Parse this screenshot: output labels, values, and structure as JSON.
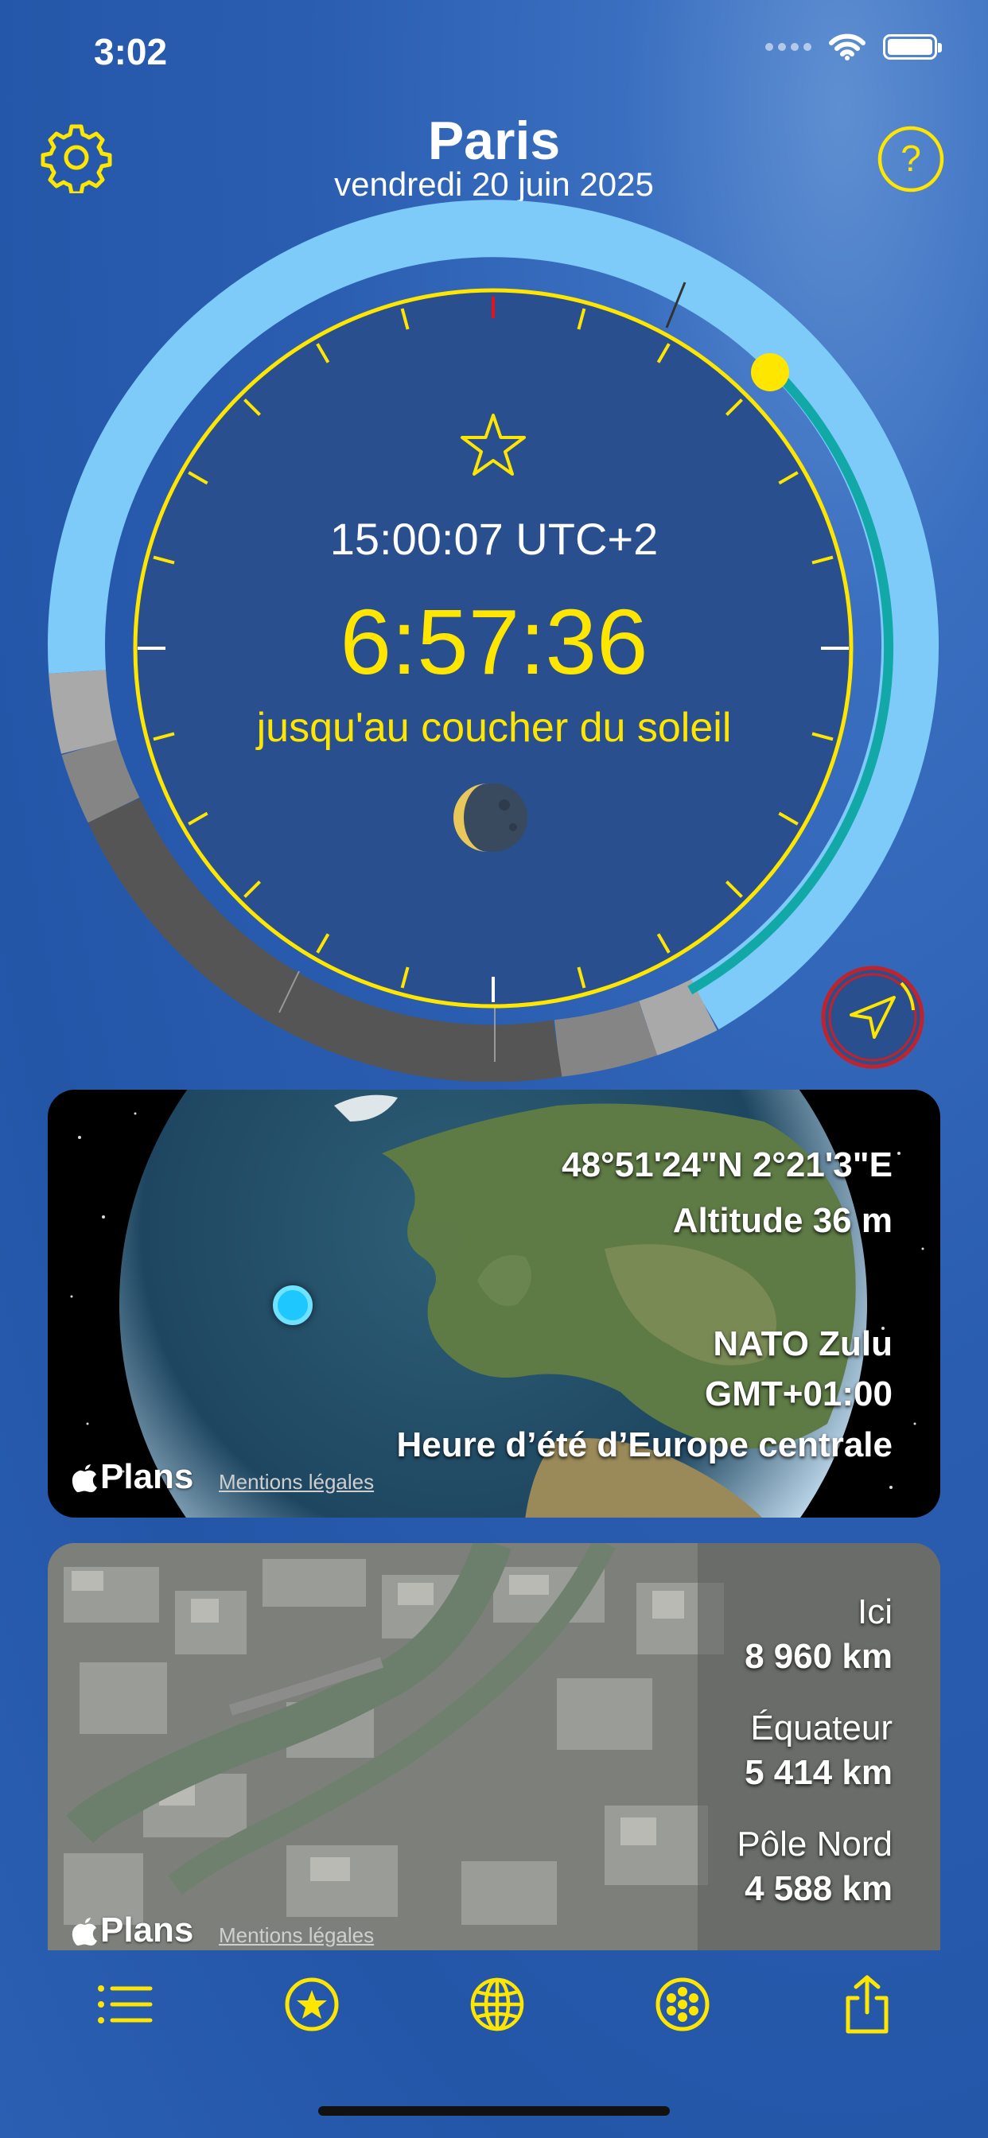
{
  "status": {
    "time": "3:02"
  },
  "header": {
    "city": "Paris",
    "date": "vendredi 20 juin 2025"
  },
  "dial": {
    "time_utc": "15:00:07 UTC+2",
    "countdown": "6:57:36",
    "event": "jusqu'au coucher du soleil"
  },
  "globe_card": {
    "coordinates": "48°51'24\"N 2°21'3\"E",
    "altitude": "Altitude 36 m",
    "military_zone": "NATO Zulu",
    "gmt_offset": "GMT+01:00",
    "timezone_name": "Heure d’été d’Europe centrale",
    "maps_brand": "Plans",
    "legal": "Mentions légales"
  },
  "city_card": {
    "here_label": "Ici",
    "here_value": "8 960 km",
    "equator_label": "Équateur",
    "equator_value": "5 414 km",
    "north_pole_label": "Pôle Nord",
    "north_pole_value": "4 588 km",
    "maps_brand": "Plans",
    "legal": "Mentions légales"
  },
  "icons": {
    "settings": "gear-icon",
    "help": "question-icon",
    "location": "location-arrow-icon",
    "tabs": [
      "list-icon",
      "star-circle-icon",
      "globe-icon",
      "dots-circle-icon",
      "share-icon"
    ]
  },
  "colors": {
    "accent": "#FFE600",
    "day_arc": "#7ECBFA",
    "night_arc": "#555555",
    "teal": "#12A8A8"
  }
}
